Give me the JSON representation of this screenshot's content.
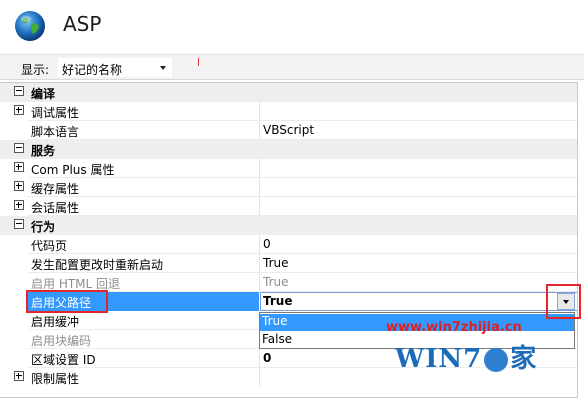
{
  "header": {
    "title": "ASP",
    "icon": "globe-icon"
  },
  "toolbar": {
    "display_label": "显示:",
    "display_value": "好记的名称"
  },
  "grid": {
    "rows": [
      {
        "type": "category",
        "label": "编译",
        "toggle": "minus"
      },
      {
        "type": "prop",
        "name": "调试属性",
        "value": "",
        "toggle": "plus"
      },
      {
        "type": "prop",
        "name": "脚本语言",
        "value": "VBScript"
      },
      {
        "type": "category",
        "label": "服务",
        "toggle": "minus"
      },
      {
        "type": "prop",
        "name": "Com Plus 属性",
        "value": "",
        "toggle": "plus"
      },
      {
        "type": "prop",
        "name": "缓存属性",
        "value": "",
        "toggle": "plus"
      },
      {
        "type": "prop",
        "name": "会话属性",
        "value": "",
        "toggle": "plus"
      },
      {
        "type": "category",
        "label": "行为",
        "toggle": "minus"
      },
      {
        "type": "prop",
        "name": "代码页",
        "value": "0"
      },
      {
        "type": "prop",
        "name": "发生配置更改时重新启动",
        "value": "True"
      },
      {
        "type": "prop",
        "name": "启用 HTML 回退",
        "value": "True",
        "disabled": true
      },
      {
        "type": "prop",
        "name": "启用父路径",
        "value": "True",
        "selected": true
      },
      {
        "type": "prop",
        "name": "启用缓冲",
        "value": ""
      },
      {
        "type": "prop",
        "name": "启用块编码",
        "value": "",
        "disabled": true
      },
      {
        "type": "prop",
        "name": "区域设置 ID",
        "value": "0"
      },
      {
        "type": "prop",
        "name": "限制属性",
        "value": "",
        "toggle": "plus"
      }
    ]
  },
  "dropdown": {
    "options": [
      "True",
      "False"
    ],
    "highlighted": 0
  },
  "watermark": {
    "url": "www.win7zhijia.cn",
    "brand_left": "WIN7",
    "brand_right": "家"
  },
  "colors": {
    "selection": "#3399ff",
    "highlight_box": "#e3262b",
    "category_bg": "#eeeeee"
  }
}
